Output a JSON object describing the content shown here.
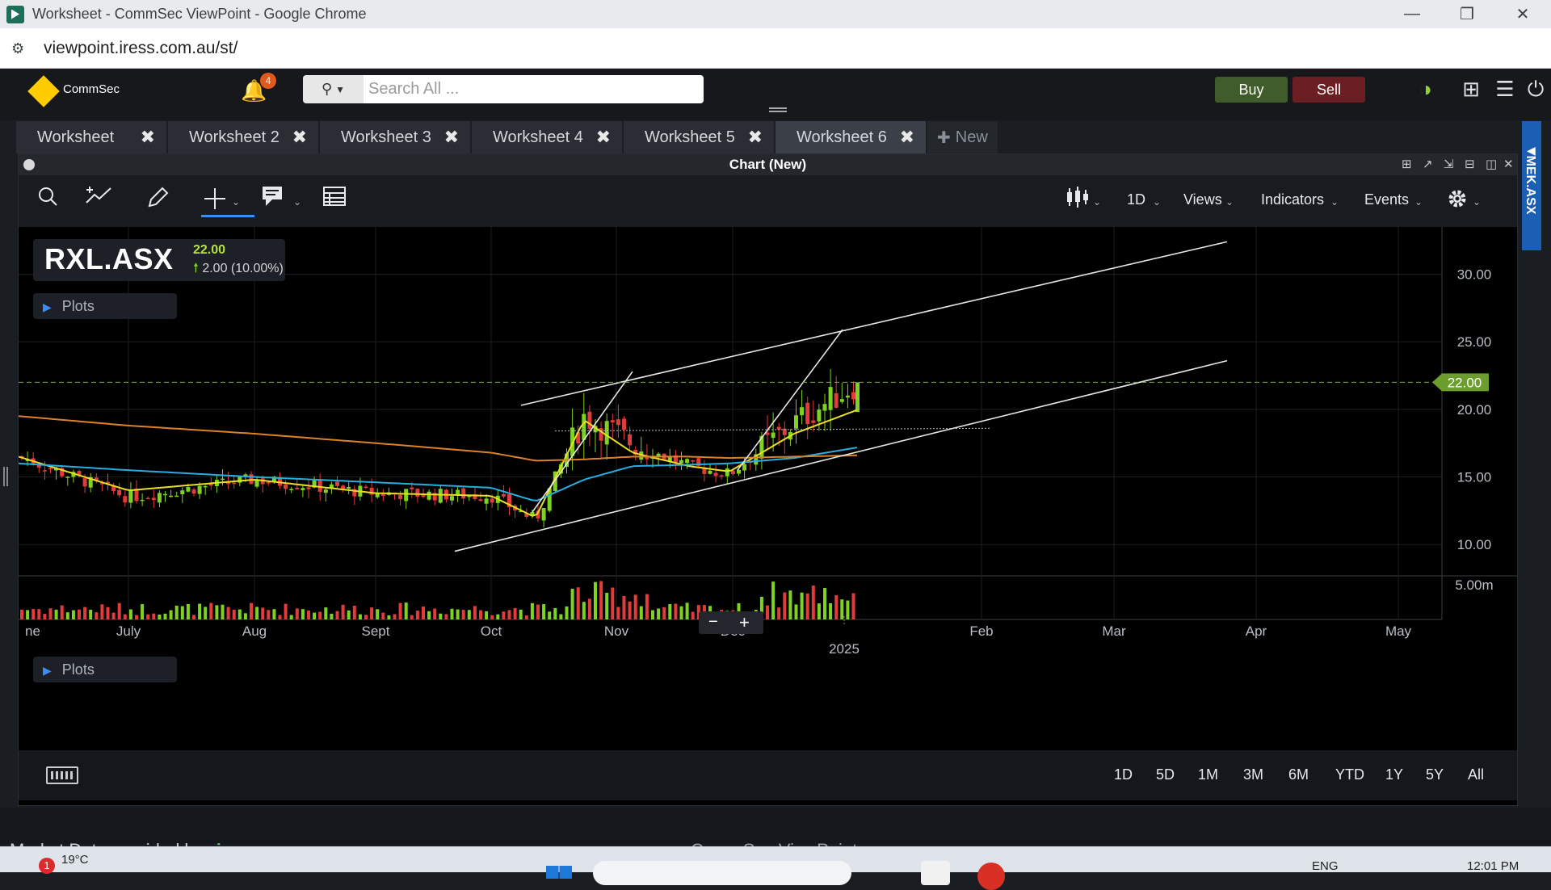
{
  "window": {
    "title": "Worksheet - CommSec ViewPoint - Google Chrome",
    "url": "viewpoint.iress.com.au/st/"
  },
  "header": {
    "brand": "CommSec",
    "notification_count": "4",
    "search_placeholder": "Search All ...",
    "buy_label": "Buy",
    "sell_label": "Sell"
  },
  "tabs": [
    {
      "label": "Worksheet"
    },
    {
      "label": "Worksheet 2"
    },
    {
      "label": "Worksheet 3"
    },
    {
      "label": "Worksheet 4"
    },
    {
      "label": "Worksheet 5"
    },
    {
      "label": "Worksheet 6"
    }
  ],
  "new_tab_label": "New",
  "panel": {
    "title": "Chart (New)",
    "side_tab_label": "MEK.ASX"
  },
  "toolbar": {
    "interval": "1D",
    "views": "Views",
    "indicators": "Indicators",
    "events": "Events"
  },
  "symbol": {
    "code": "RXL.ASX",
    "price": "22.00",
    "change": "2.00 (10.00%)"
  },
  "plots_label": "Plots",
  "ranges": [
    "1D",
    "5D",
    "1M",
    "3M",
    "6M",
    "YTD",
    "1Y",
    "5Y",
    "All"
  ],
  "footer": {
    "provider": "Market Data provided by",
    "provider_brand": "iress",
    "center": "CommSec ViewPoint"
  },
  "taskbar": {
    "weather": "19°C",
    "weather_badge": "1",
    "language": "ENG",
    "time": "12:01 PM"
  },
  "colors": {
    "up": "#7ed321",
    "down": "#e23b3b",
    "ma_short": "#e8e020",
    "ma_mid": "#27aee0",
    "ma_long": "#d9822b",
    "last_price_tag": "#6c9e2e",
    "accent": "#3b8cf5"
  },
  "chart_data": {
    "type": "candlestick",
    "last_price_label": "22.00",
    "y_ticks": [
      "30.00",
      "25.00",
      "20.00",
      "15.00",
      "10.00"
    ],
    "y_range": [
      7.8,
      33.5
    ],
    "volume_tick": "5.00m",
    "x_ticks": [
      "ne",
      "July",
      "Aug",
      "Sept",
      "Oct",
      "Nov",
      "Dec",
      "2025",
      "Feb",
      "Mar",
      "Apr",
      "May"
    ],
    "gridlines": true,
    "price_samples": [
      [
        "Jun",
        16.5
      ],
      [
        "July",
        13.5
      ],
      [
        "Aug",
        14.8
      ],
      [
        "Sept",
        13.8
      ],
      [
        "Oct",
        13.6
      ],
      [
        "mid-Oct",
        11.8
      ],
      [
        "late-Oct",
        19.5
      ],
      [
        "Nov",
        17.5
      ],
      [
        "mid-Nov",
        15.8
      ],
      [
        "Dec",
        15.2
      ],
      [
        "mid-Dec",
        19.0
      ],
      [
        "late-Dec",
        22.0
      ]
    ],
    "moving_averages": [
      {
        "color": "yellow",
        "samples": [
          16.5,
          14.0,
          14.8,
          13.8,
          13.6,
          12.0,
          19.2,
          16.8,
          15.8,
          15.4,
          18.2,
          20.0
        ]
      },
      {
        "color": "cyan",
        "samples": [
          16.0,
          15.5,
          15.0,
          14.6,
          14.2,
          13.2,
          14.8,
          15.8,
          15.9,
          16.0,
          16.4,
          17.2
        ]
      },
      {
        "color": "orange",
        "samples": [
          19.5,
          18.8,
          18.2,
          17.5,
          16.8,
          16.2,
          16.3,
          16.5,
          16.5,
          16.4,
          16.5,
          16.6
        ]
      }
    ],
    "drawn_lines": "ascending channel and two trend lines"
  }
}
